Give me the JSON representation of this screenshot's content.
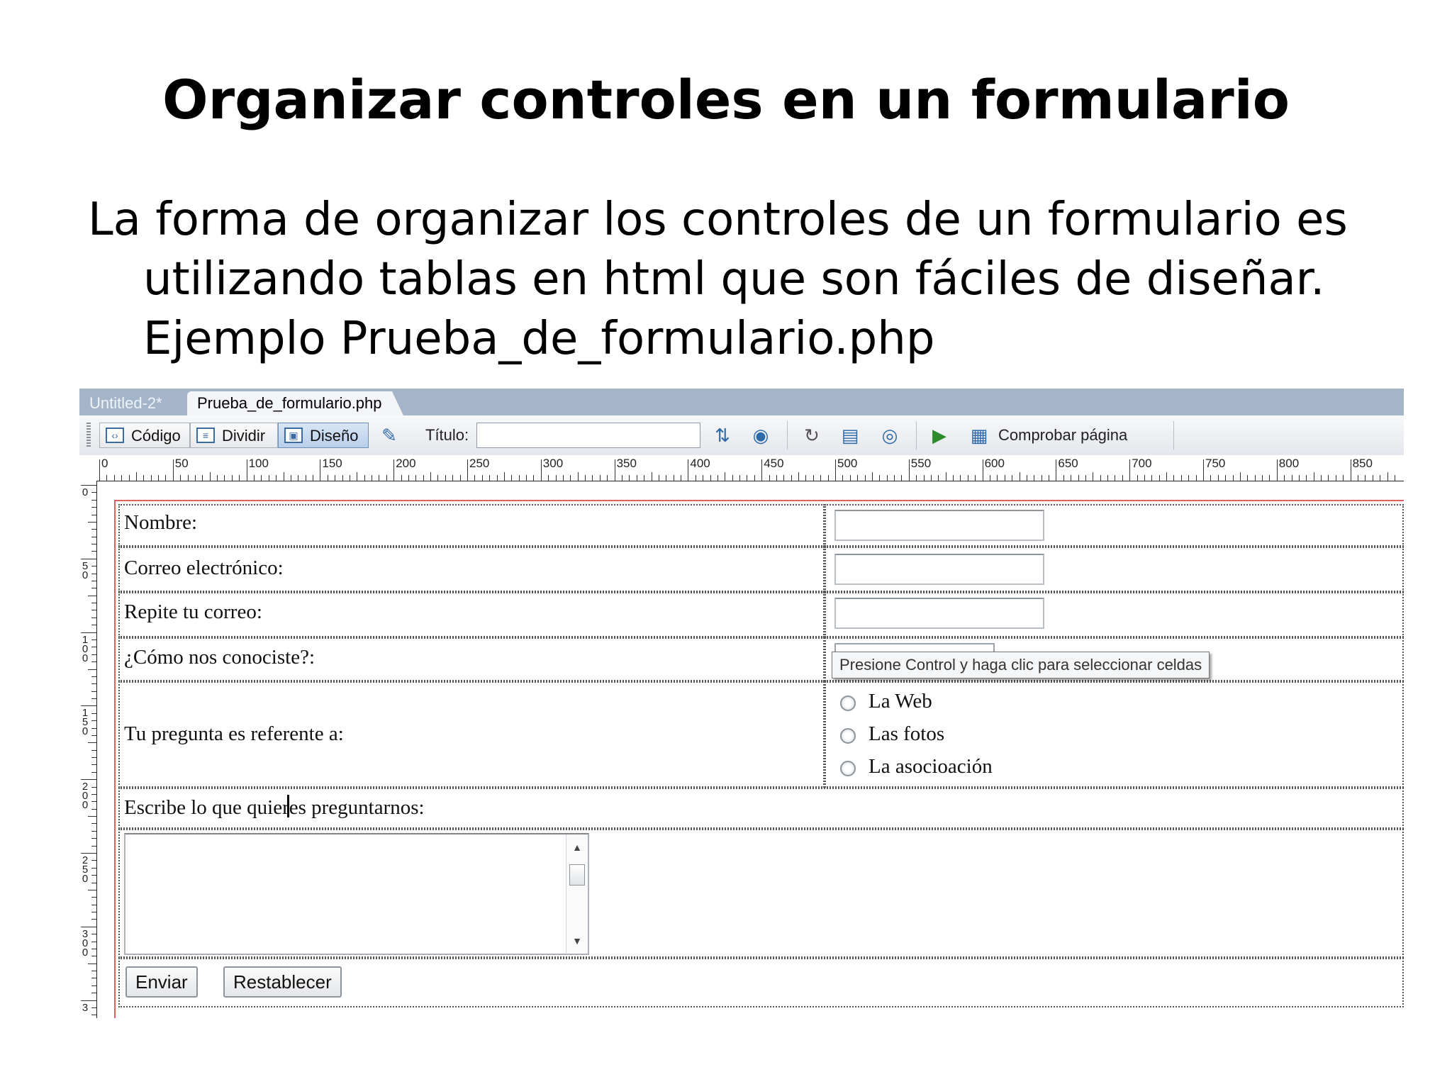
{
  "slide": {
    "title": "Organizar controles en un formulario",
    "body_lines": [
      "La forma de organizar los controles de un formulario es",
      "utilizando tablas en html que son fáciles de diseñar.",
      "Ejemplo Prueba_de_formulario.php"
    ]
  },
  "editor": {
    "tabs": [
      {
        "label": "Untitled-2*",
        "active": false
      },
      {
        "label": "Prueba_de_formulario.php",
        "active": true
      }
    ],
    "toolbar": {
      "code_label": "Código",
      "split_label": "Dividir",
      "design_label": "Diseño",
      "title_label": "Título:",
      "title_value": "",
      "check_page_label": "Comprobar página"
    },
    "ruler_h_labels": [
      "0",
      "50",
      "100",
      "150",
      "200",
      "250",
      "300",
      "350",
      "400",
      "450",
      "500",
      "550",
      "600",
      "650",
      "700",
      "750",
      "800",
      "850"
    ],
    "ruler_v_labels": [
      "0",
      "50",
      "100",
      "150",
      "200",
      "250",
      "300",
      "3"
    ]
  },
  "form": {
    "name_label": "Nombre:",
    "email_label": "Correo electrónico:",
    "repeat_email_label": "Repite tu correo:",
    "how_label": "¿Cómo nos conociste?:",
    "question_label": "Tu pregunta es referente a:",
    "radio_options": [
      "La Web",
      "Las fotos",
      "La asocioación"
    ],
    "write_label": "Escribe lo que quieres preguntarnos:",
    "submit_label": "Enviar",
    "reset_label": "Restablecer",
    "tooltip": "Presione Control y haga clic para seleccionar celdas"
  }
}
